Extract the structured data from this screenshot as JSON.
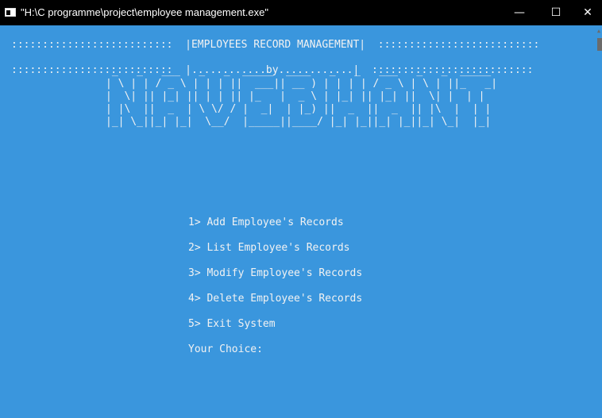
{
  "window": {
    "title": "\"H:\\C programme\\project\\employee management.exe\"",
    "minimize_glyph": "—",
    "maximize_glyph": "☐",
    "close_glyph": "✕",
    "icon": "console-app-icon"
  },
  "console": {
    "header_line_1": "::::::::::::::::::::::::::  |EMPLOYEES RECORD MANAGEMENT|  ::::::::::::::::::::::::::",
    "header_line_2": "::::::::::::::::::::::::::  |............by............|  ::::::::::::::::::::::::::",
    "ascii_art": " _   _   ___   _   _  _____  ____   _   _   ___   _   _  _____ \n| \\ | | / _ \\ | | | ||  ___|| __ ) | | | | / _ \\ | \\ | ||_   _|\n|  \\| || |_| || | | || |_   |  _ \\ | |_| || |_| ||  \\| |  | |  \n| |\\  ||  _  | \\ \\/ / |  _|  | |_) ||  _  ||  _  || |\\  |  | |  \n|_| \\_||_| |_|  \\__/  |_____||____/ |_| |_||_| |_||_| \\_|  |_|  ",
    "menu": [
      "1> Add Employee's Records",
      "2> List Employee's Records",
      "3> Modify Employee's Records",
      "4> Delete Employee's Records",
      "5> Exit System"
    ],
    "prompt": "Your Choice:"
  },
  "colors": {
    "console_bg": "#3a96dd",
    "console_fg": "#f2f2f2",
    "titlebar_bg": "#000000"
  }
}
